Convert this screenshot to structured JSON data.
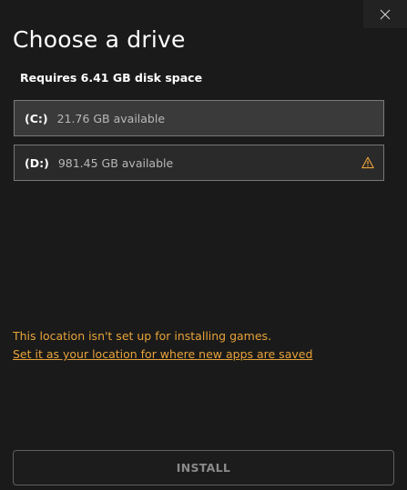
{
  "dialog": {
    "title": "Choose a drive",
    "requirement": "Requires 6.41 GB disk space",
    "close_icon": "close-icon"
  },
  "drives": [
    {
      "letter": "(C:)",
      "available": "21.76 GB available",
      "selected": true,
      "warning": false
    },
    {
      "letter": "(D:)",
      "available": "981.45 GB available",
      "selected": false,
      "warning": true,
      "warning_icon": "warning-triangle-icon"
    }
  ],
  "warning": {
    "message": "This location isn't set up for installing games.",
    "link": "Set it as your location for where new apps are saved"
  },
  "footer": {
    "install_label": "INSTALL",
    "install_enabled": false
  },
  "colors": {
    "background": "#1a1a1a",
    "warning": "#e8a339",
    "selected_drive_bg": "#3a3a3a",
    "drive_border": "#6b6b6b",
    "disabled_text": "#8a8a8a"
  }
}
